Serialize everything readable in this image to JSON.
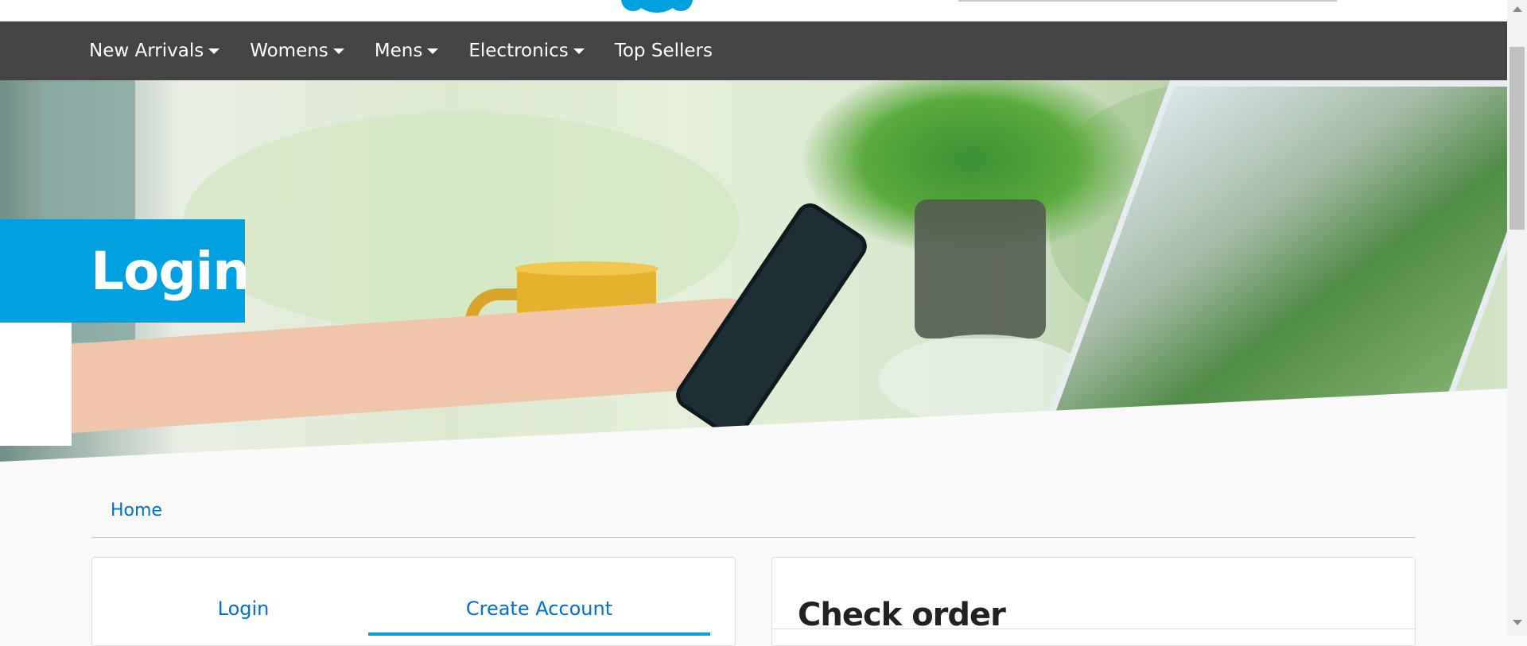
{
  "nav": {
    "items": [
      {
        "label": "New Arrivals",
        "has_dropdown": true
      },
      {
        "label": "Womens",
        "has_dropdown": true
      },
      {
        "label": "Mens",
        "has_dropdown": true
      },
      {
        "label": "Electronics",
        "has_dropdown": true
      },
      {
        "label": "Top Sellers",
        "has_dropdown": false
      }
    ]
  },
  "hero": {
    "title": "Login"
  },
  "breadcrumb": {
    "home": "Home"
  },
  "account_card": {
    "tabs": [
      {
        "label": "Login",
        "active": false
      },
      {
        "label": "Create Account",
        "active": true
      }
    ]
  },
  "check_order_card": {
    "title": "Check order"
  },
  "colors": {
    "brand_blue": "#00a1e0",
    "link_blue": "#0070d2",
    "navbar_bg": "#444444"
  },
  "icons": {
    "dropdown": "caret-down-icon",
    "scroll_up": "scroll-up-arrow-icon",
    "scroll_down": "scroll-down-arrow-icon"
  }
}
